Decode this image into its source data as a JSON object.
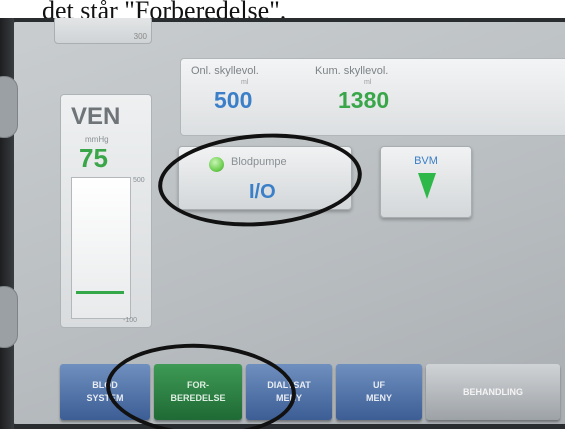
{
  "caption": "det står \"Forberedelse\".",
  "top_tab": {
    "scale_label": "300"
  },
  "ven": {
    "title": "VEN",
    "unit": "mmHg",
    "value": "75",
    "scale_max": "500",
    "scale_min": "-100",
    "level_fraction": 0.18
  },
  "volumes": {
    "online": {
      "label": "Onl. skyllevol.",
      "unit": "ml",
      "value": "500",
      "color": "#3a7fc8"
    },
    "cumulative": {
      "label": "Kum. skyllevol.",
      "unit": "ml",
      "value": "1380",
      "color": "#3aa64a"
    }
  },
  "blood_pump": {
    "label": "Blodpumpe",
    "value": "I/O",
    "status_color": "#6fcf52"
  },
  "bvm": {
    "label": "BVM",
    "icon": "bvm-indicator-icon"
  },
  "nav": {
    "blood_system": [
      "BLOD",
      "SYSTEM"
    ],
    "preparation": [
      "FOR-",
      "BEREDELSE"
    ],
    "dialysate_menu": [
      "DIALYSAT",
      "MENY"
    ],
    "uf_menu": [
      "UF",
      "MENY"
    ],
    "treatment": "BEHANDLING"
  }
}
